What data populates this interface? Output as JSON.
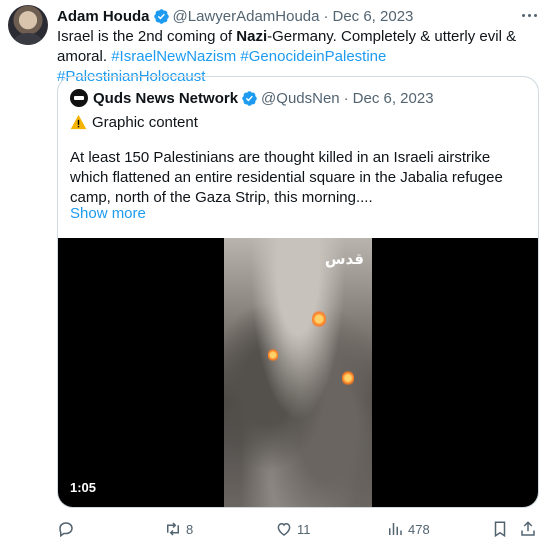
{
  "tweet": {
    "author_name": "Adam Houda",
    "handle": "@LawyerAdamHouda",
    "separator": "·",
    "date": "Dec 6, 2023",
    "text_part1": "Israel is the 2nd coming of ",
    "text_bold": "Nazi",
    "text_part2": "-Germany. Completely & utterly evil & amoral. ",
    "hashtags": [
      "#IsraelNewNazism",
      "#GenocideinPalestine",
      "#PalestinianHolocaust"
    ]
  },
  "quote": {
    "author_name": "Quds News Network",
    "handle": "@QudsNen",
    "separator": "·",
    "date": "Dec 6, 2023",
    "warning": "Graphic content",
    "text": "At least 150 Palestinians are thought killed in an Israeli airstrike which flattened an entire residential square in the Jabalia refugee camp, north of the Gaza Strip, this morning....",
    "show_more": "Show more",
    "video": {
      "watermark": "قدس",
      "duration": "1:05"
    }
  },
  "actions": {
    "reply_icon": "reply-icon",
    "retweet_count": "8",
    "like_count": "11",
    "views_count": "478",
    "bookmark_icon": "bookmark-icon",
    "share_icon": "share-icon"
  },
  "colors": {
    "accent": "#1d9bf0",
    "text": "#0f1419",
    "muted": "#536471",
    "border": "#cfd9de"
  }
}
